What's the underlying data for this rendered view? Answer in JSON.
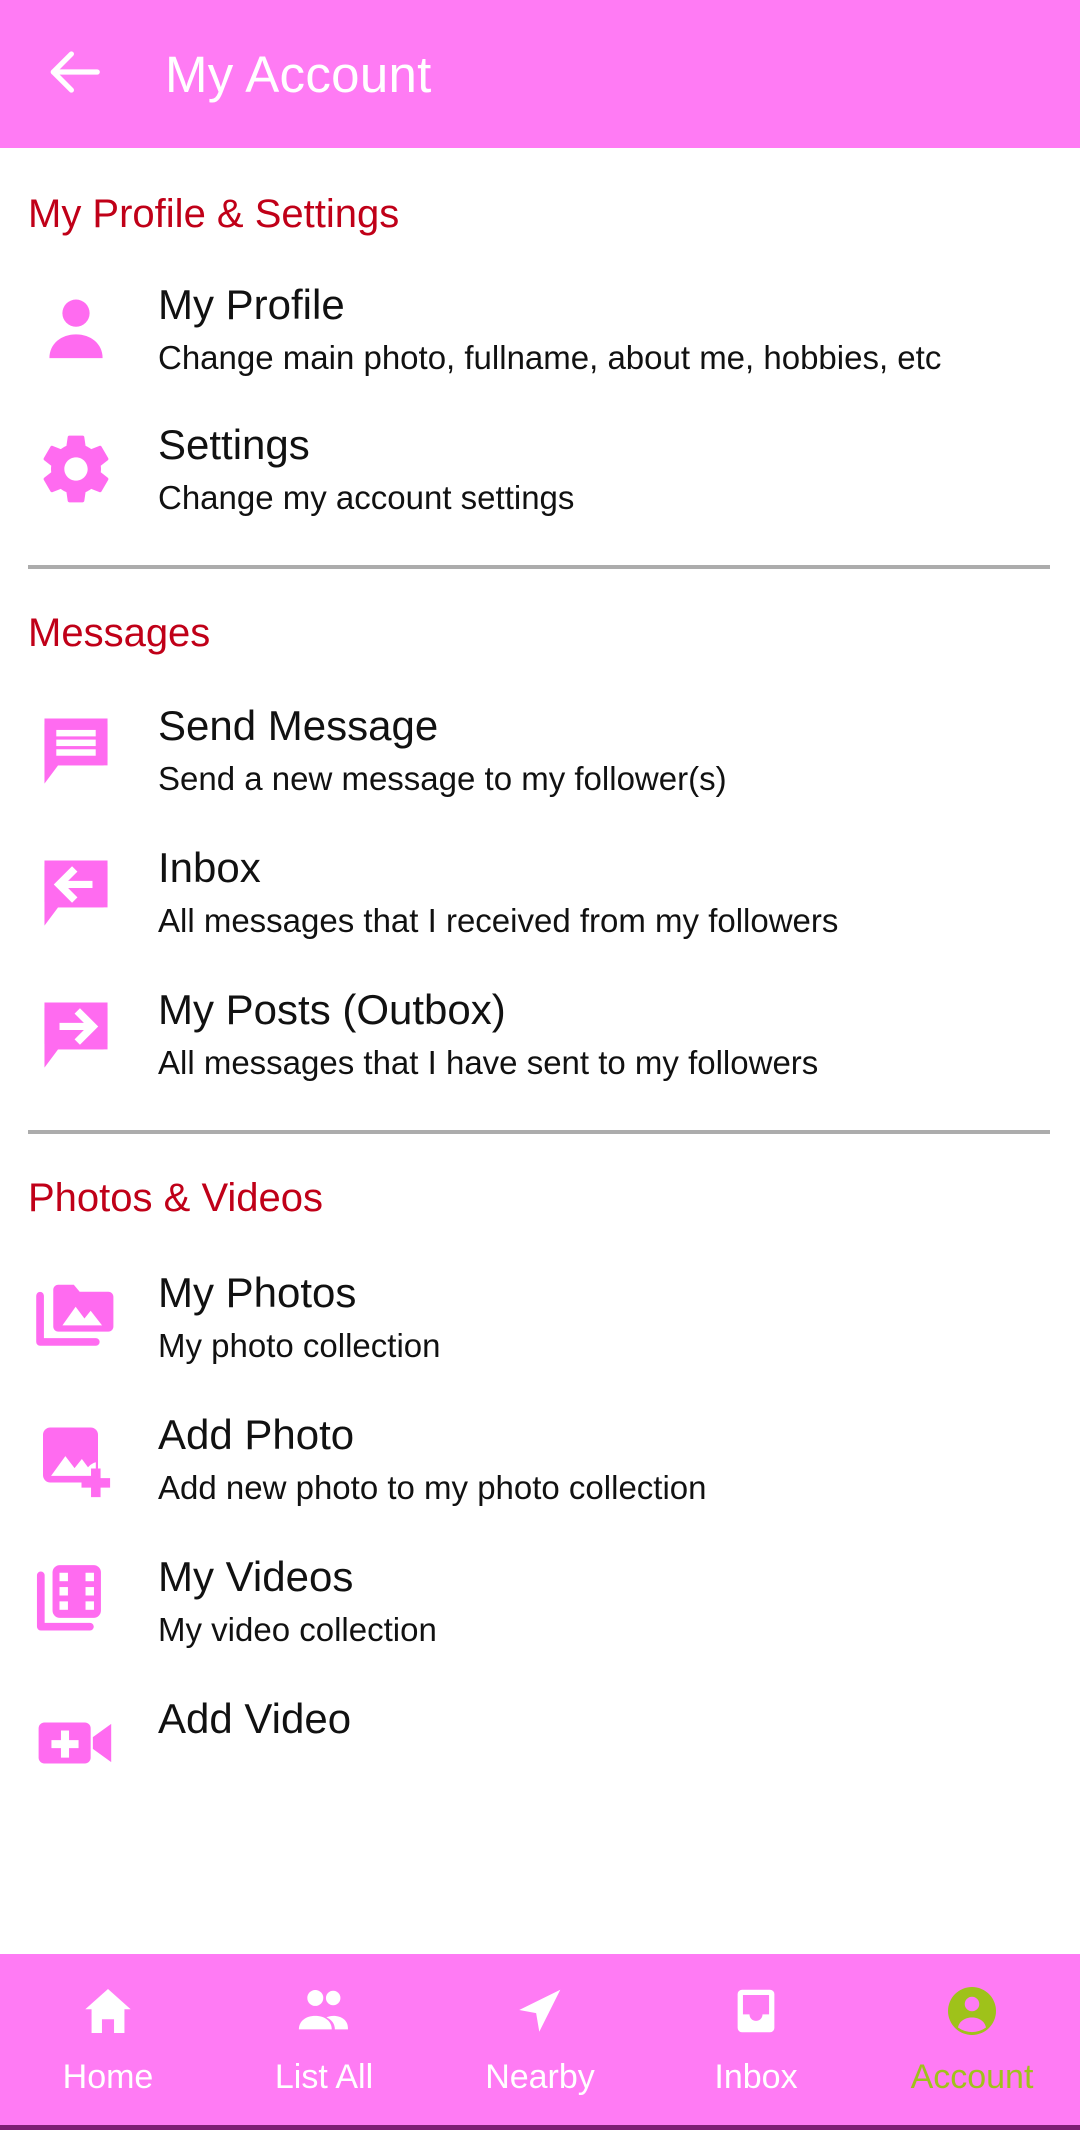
{
  "appbar": {
    "back_icon": "arrow-left-icon",
    "title": "My Account"
  },
  "theme": {
    "primary_pink": "#FF7BF4",
    "section_heading_red": "#C00018",
    "icon_pink": "#FF6BF0",
    "active_nav_olive": "#9FC21A",
    "divider_gray": "#ACACAC",
    "body_text": "#111111",
    "appbar_text": "#FFFFFF"
  },
  "sections": [
    {
      "title": "My Profile & Settings",
      "items": [
        {
          "icon": "person-icon",
          "title": "My Profile",
          "subtitle": "Change main photo, fullname, about me, hobbies, etc"
        },
        {
          "icon": "gear-icon",
          "title": "Settings",
          "subtitle": "Change my account settings"
        }
      ]
    },
    {
      "title": "Messages",
      "items": [
        {
          "icon": "chat-bubble-lines-icon",
          "title": "Send Message",
          "subtitle": "Send a new message to my follower(s)"
        },
        {
          "icon": "chat-bubble-arrow-left-icon",
          "title": "Inbox",
          "subtitle": "All messages that I received from my followers"
        },
        {
          "icon": "chat-bubble-arrow-right-icon",
          "title": "My Posts (Outbox)",
          "subtitle": "All messages that I have sent to my followers"
        }
      ]
    },
    {
      "title": "Photos & Videos",
      "items": [
        {
          "icon": "photo-folder-icon",
          "title": "My Photos",
          "subtitle": "My photo collection"
        },
        {
          "icon": "add-photo-icon",
          "title": "Add Photo",
          "subtitle": "Add new photo to my photo collection"
        },
        {
          "icon": "film-strip-icon",
          "title": "My Videos",
          "subtitle": "My video collection"
        },
        {
          "icon": "add-video-icon",
          "title": "Add Video",
          "subtitle": ""
        }
      ]
    }
  ],
  "bottom_nav": {
    "items": [
      {
        "icon": "home-icon",
        "label": "Home",
        "active": false
      },
      {
        "icon": "people-icon",
        "label": "List All",
        "active": false
      },
      {
        "icon": "navigate-icon",
        "label": "Nearby",
        "active": false
      },
      {
        "icon": "inbox-tray-icon",
        "label": "Inbox",
        "active": false
      },
      {
        "icon": "account-circle-icon",
        "label": "Account",
        "active": true
      }
    ]
  }
}
